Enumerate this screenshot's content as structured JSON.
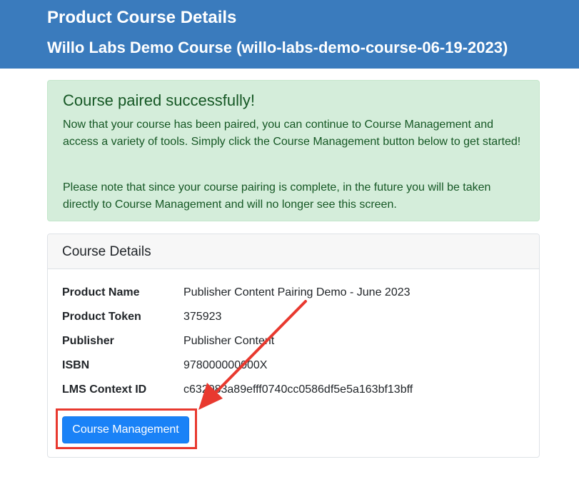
{
  "header": {
    "title": "Product Course Details",
    "subtitle": "Willo Labs Demo Course (willo-labs-demo-course-06-19-2023)"
  },
  "alert": {
    "heading": "Course paired successfully!",
    "paragraph1": "Now that your course has been paired, you can continue to Course Management and access a variety of tools. Simply click the Course Management button below to get started!",
    "paragraph2": "Please note that since your course pairing is complete, in the future you will be taken directly to Course Management and will no longer see this screen."
  },
  "card": {
    "title": "Course Details",
    "rows": [
      {
        "label": "Product Name",
        "value": "Publisher Content Pairing Demo - June 2023"
      },
      {
        "label": "Product Token",
        "value": "375923"
      },
      {
        "label": "Publisher",
        "value": "Publisher Content"
      },
      {
        "label": "ISBN",
        "value": "978000000000X"
      },
      {
        "label": "LMS Context ID",
        "value": "c632083a89efff0740cc0586df5e5a163bf13bff"
      }
    ],
    "button_label": "Course Management"
  },
  "colors": {
    "header_bg": "#3a7bbd",
    "alert_bg": "#d4edda",
    "alert_text": "#155724",
    "button_bg": "#1a82f7",
    "annotation_red": "#e8392f"
  }
}
